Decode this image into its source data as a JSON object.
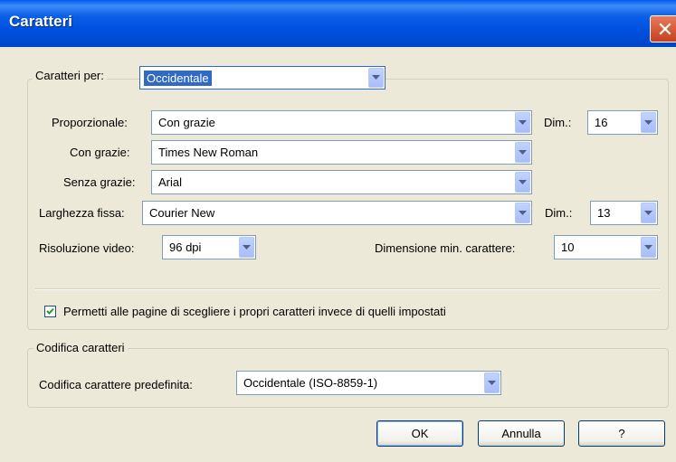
{
  "window": {
    "title": "Caratteri",
    "close_icon": "close-icon"
  },
  "fonts_group": {
    "legend": "Caratteri per:",
    "charset_value": "Occidentale",
    "rows": [
      {
        "label": "Proporzionale:",
        "value": "Con grazie"
      },
      {
        "label": "Con grazie:",
        "value": "Times New Roman"
      },
      {
        "label": "Senza grazie:",
        "value": "Arial"
      },
      {
        "label": "Larghezza fissa:",
        "value": "Courier New"
      }
    ],
    "size_label_1": "Dim.:",
    "size_value_1": "16",
    "size_label_2": "Dim.:",
    "size_value_2": "13",
    "resolution_label": "Risoluzione video:",
    "resolution_value": "96 dpi",
    "min_size_label": "Dimensione min. carattere:",
    "min_size_value": "10",
    "allow_pages_label": "Permetti alle pagine di scegliere i propri caratteri invece di quelli impostati",
    "allow_pages_checked": true
  },
  "encoding_group": {
    "legend": "Codifica caratteri",
    "default_label": "Codifica carattere predefinita:",
    "default_value": "Occidentale (ISO-8859-1)"
  },
  "buttons": {
    "ok": "OK",
    "cancel": "Annulla",
    "help": "?"
  }
}
